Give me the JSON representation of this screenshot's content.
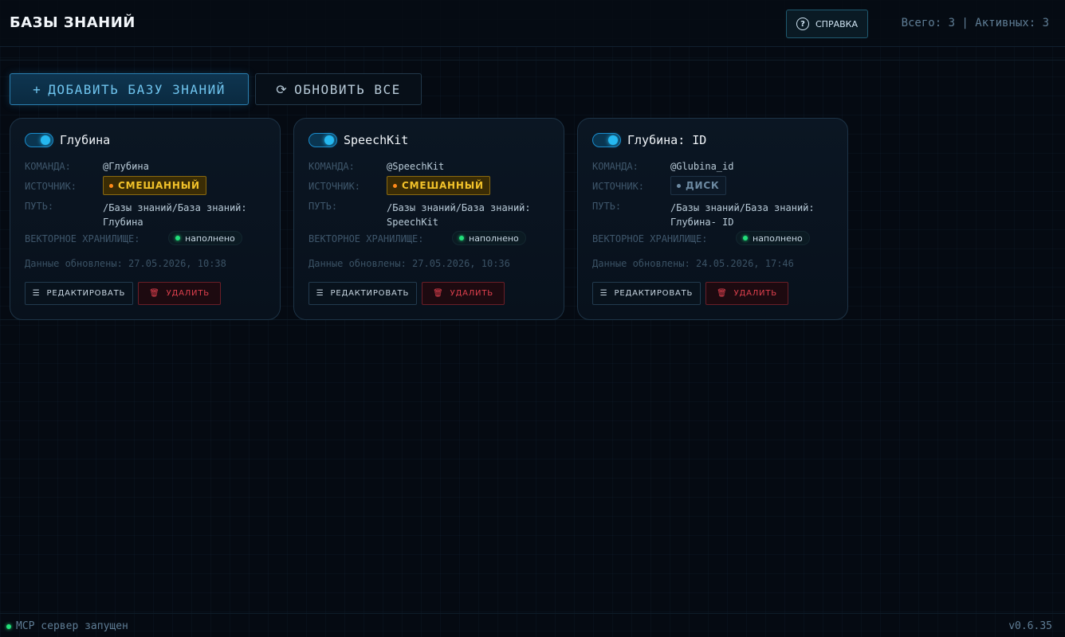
{
  "header": {
    "title": "БАЗЫ ЗНАНИЙ",
    "help_label": "СПРАВКА",
    "help_icon": "?",
    "stats": "Всего: 3 | Активных: 3"
  },
  "toolbar": {
    "add_icon": "+",
    "add_label": "ДОБАВИТЬ БАЗУ ЗНАНИЙ",
    "refresh_icon": "⟳",
    "refresh_label": "ОБНОВИТЬ ВСЕ"
  },
  "labels": {
    "command": "КОМАНДА:",
    "source": "ИСТОЧНИК:",
    "path": "ПУТЬ:",
    "vector_store": "ВЕКТОРНОЕ ХРАНИЛИЩЕ:",
    "edit": "РЕДАКТИРОВАТЬ",
    "delete": "УДАЛИТЬ"
  },
  "cards": [
    {
      "name": "Глубина",
      "command": "@Глубина",
      "source": "СМЕШАННЫЙ",
      "path": "/Базы знаний/База знаний: Глубина",
      "vector_status": "наполнено",
      "updated": "Данные обновлены: 27.05.2026, 10:38",
      "enabled": true
    },
    {
      "name": "SpeechKit",
      "command": "@SpeechKit",
      "source": "СМЕШАННЫЙ",
      "path": "/Базы знаний/База знаний: SpeechKit",
      "vector_status": "наполнено",
      "updated": "Данные обновлены: 27.05.2026, 10:36",
      "enabled": true
    },
    {
      "name": "Глубина: ID",
      "command": "@Glubina_id",
      "source": "ДИСК",
      "path": "/Базы знаний/База знаний: Глубина- ID",
      "vector_status": "наполнено",
      "updated": "Данные обновлены: 24.05.2026, 17:46",
      "enabled": true
    }
  ],
  "footer": {
    "status": "MCP сервер запущен",
    "version": "v0.6.35"
  },
  "colors": {
    "background": "#050a12",
    "accent": "#25b8f0",
    "mixed_badge": "#f2c22a",
    "delete": "#e0404e",
    "ok": "#22e07a"
  }
}
